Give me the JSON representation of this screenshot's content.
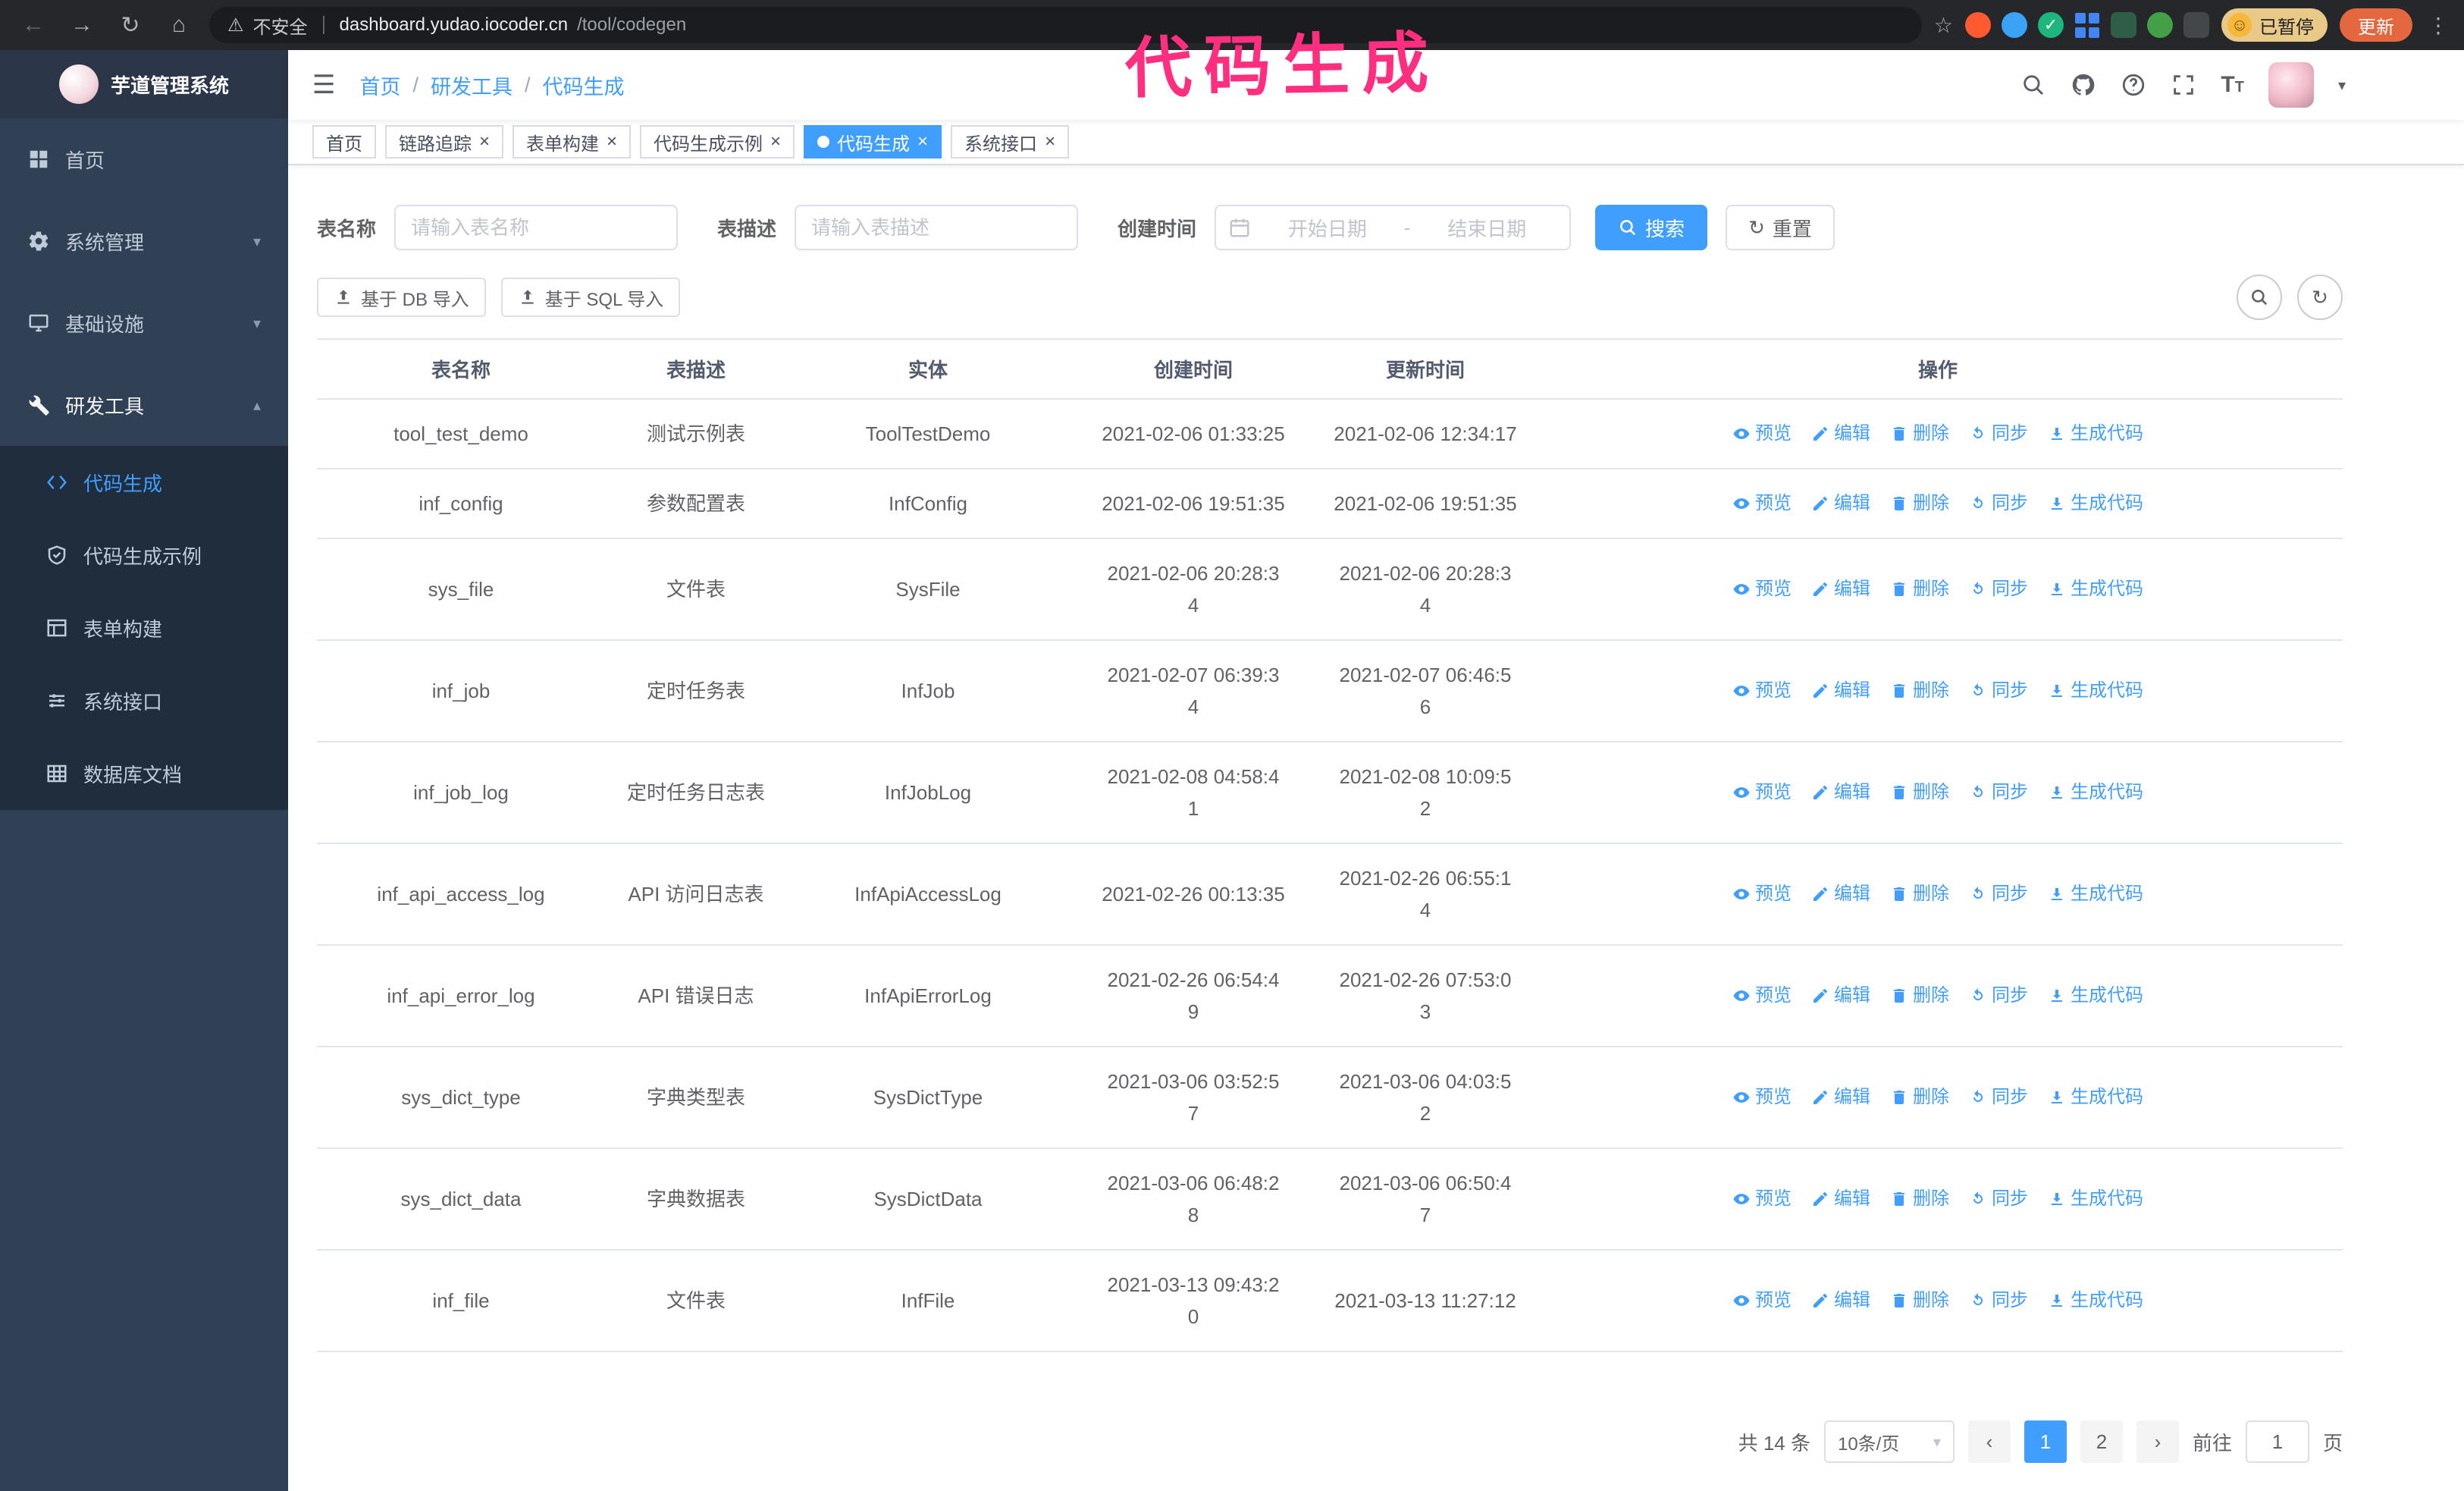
{
  "annotation": {
    "text": "代码生成",
    "color": "#ff2e7e"
  },
  "browser": {
    "security_label": "不安全",
    "url_host": "dashboard.yudao.iocoder.cn",
    "url_path": "/tool/codegen",
    "paused_badge": "已暂停",
    "update_button": "更新",
    "extensions": [
      {
        "name": "extension-icon-1",
        "color": "#ff5a32",
        "shape": "circle"
      },
      {
        "name": "extension-icon-2",
        "color": "#3aa3f5",
        "shape": "drop"
      },
      {
        "name": "extension-icon-3",
        "color": "#1fb57f",
        "shape": "check"
      },
      {
        "name": "extension-icon-4",
        "color": "#4285f4",
        "shape": "grid"
      },
      {
        "name": "extension-icon-5",
        "color": "#2e5e46",
        "shape": "square"
      },
      {
        "name": "extension-icon-6",
        "color": "#43a047",
        "shape": "circle"
      },
      {
        "name": "extension-icon-7",
        "color": "#44474a",
        "shape": "square"
      }
    ]
  },
  "sidebar": {
    "logo_title": "芋道管理系统",
    "items": [
      {
        "id": "home",
        "label": "首页",
        "icon": "home-icon"
      },
      {
        "id": "system",
        "label": "系统管理",
        "icon": "gear-icon",
        "chevron": "down"
      },
      {
        "id": "infra",
        "label": "基础设施",
        "icon": "monitor-icon",
        "chevron": "down"
      },
      {
        "id": "devtools",
        "label": "研发工具",
        "icon": "wrench-icon",
        "chevron": "up",
        "expanded": true
      }
    ],
    "sub_items": [
      {
        "id": "codegen",
        "label": "代码生成",
        "icon": "code-icon",
        "active": true
      },
      {
        "id": "codegen-example",
        "label": "代码生成示例",
        "icon": "shield-check-icon"
      },
      {
        "id": "form-builder",
        "label": "表单构建",
        "icon": "form-icon"
      },
      {
        "id": "system-api",
        "label": "系统接口",
        "icon": "api-icon"
      },
      {
        "id": "db-doc",
        "label": "数据库文档",
        "icon": "database-icon"
      }
    ]
  },
  "header": {
    "breadcrumb": [
      "首页",
      "研发工具",
      "代码生成"
    ]
  },
  "tabs": [
    {
      "id": "home",
      "label": "首页",
      "closable": false,
      "active": false
    },
    {
      "id": "tracing",
      "label": "链路追踪",
      "closable": true,
      "active": false
    },
    {
      "id": "form-builder",
      "label": "表单构建",
      "closable": true,
      "active": false
    },
    {
      "id": "codegen-example",
      "label": "代码生成示例",
      "closable": true,
      "active": false
    },
    {
      "id": "codegen",
      "label": "代码生成",
      "closable": true,
      "active": true
    },
    {
      "id": "system-api",
      "label": "系统接口",
      "closable": true,
      "active": false
    }
  ],
  "filters": {
    "table_name_label": "表名称",
    "table_name_placeholder": "请输入表名称",
    "table_desc_label": "表描述",
    "table_desc_placeholder": "请输入表描述",
    "create_time_label": "创建时间",
    "date_start_placeholder": "开始日期",
    "date_separator": "-",
    "date_end_placeholder": "结束日期",
    "search_button": "搜索",
    "reset_button": "重置"
  },
  "toolbar": {
    "import_db": "基于 DB 导入",
    "import_sql": "基于 SQL 导入"
  },
  "table": {
    "columns": [
      "表名称",
      "表描述",
      "实体",
      "创建时间",
      "更新时间",
      "操作"
    ],
    "actions": [
      {
        "id": "preview",
        "label": "预览",
        "icon": "eye-icon"
      },
      {
        "id": "edit",
        "label": "编辑",
        "icon": "edit-icon"
      },
      {
        "id": "delete",
        "label": "删除",
        "icon": "delete-icon"
      },
      {
        "id": "sync",
        "label": "同步",
        "icon": "sync-icon"
      },
      {
        "id": "generate",
        "label": "生成代码",
        "icon": "download-icon"
      }
    ],
    "rows": [
      {
        "name": "tool_test_demo",
        "desc": "测试示例表",
        "entity": "ToolTestDemo",
        "created": "2021-02-06 01:33:25",
        "updated": "2021-02-06 12:34:17"
      },
      {
        "name": "inf_config",
        "desc": "参数配置表",
        "entity": "InfConfig",
        "created": "2021-02-06 19:51:35",
        "updated": "2021-02-06 19:51:35"
      },
      {
        "name": "sys_file",
        "desc": "文件表",
        "entity": "SysFile",
        "created": "2021-02-06 20:28:3\n4",
        "updated": "2021-02-06 20:28:3\n4"
      },
      {
        "name": "inf_job",
        "desc": "定时任务表",
        "entity": "InfJob",
        "created": "2021-02-07 06:39:3\n4",
        "updated": "2021-02-07 06:46:5\n6"
      },
      {
        "name": "inf_job_log",
        "desc": "定时任务日志表",
        "entity": "InfJobLog",
        "created": "2021-02-08 04:58:4\n1",
        "updated": "2021-02-08 10:09:5\n2"
      },
      {
        "name": "inf_api_access_log",
        "desc": "API 访问日志表",
        "entity": "InfApiAccessLog",
        "created": "2021-02-26 00:13:35",
        "updated": "2021-02-26 06:55:1\n4"
      },
      {
        "name": "inf_api_error_log",
        "desc": "API 错误日志",
        "entity": "InfApiErrorLog",
        "created": "2021-02-26 06:54:4\n9",
        "updated": "2021-02-26 07:53:0\n3"
      },
      {
        "name": "sys_dict_type",
        "desc": "字典类型表",
        "entity": "SysDictType",
        "created": "2021-03-06 03:52:5\n7",
        "updated": "2021-03-06 04:03:5\n2"
      },
      {
        "name": "sys_dict_data",
        "desc": "字典数据表",
        "entity": "SysDictData",
        "created": "2021-03-06 06:48:2\n8",
        "updated": "2021-03-06 06:50:4\n7"
      },
      {
        "name": "inf_file",
        "desc": "文件表",
        "entity": "InfFile",
        "created": "2021-03-13 09:43:2\n0",
        "updated": "2021-03-13 11:27:12"
      }
    ]
  },
  "pagination": {
    "total": "共 14 条",
    "page_size": "10条/页",
    "pages": [
      {
        "label": "1",
        "active": true
      },
      {
        "label": "2",
        "active": false
      }
    ],
    "goto_label": "前往",
    "goto_value": "1",
    "goto_suffix": "页"
  },
  "theme": {
    "accent": "#409eff",
    "sidebar_bg": "#304156",
    "submenu_bg": "#1f2d3d",
    "link_color": "#409eff",
    "annotation_color": "#ff2e7e",
    "update_button_bg": "#e5673f",
    "paused_chip_bg": "#e9c987"
  }
}
